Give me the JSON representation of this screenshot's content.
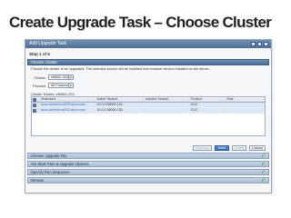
{
  "slide": {
    "title": "Create Upgrade Task – Choose Cluster"
  },
  "dialog": {
    "title": "Add Upgrade Task",
    "step": "Step 1 of 5",
    "sections": {
      "choose_cluster": "Choose Cluster",
      "choose_upgrade_file": "Choose Upgrade File",
      "set_start_time": "Set Start Time & Upgrade Options",
      "specify_run_sequence": "Specify Run Sequence",
      "review": "Review"
    },
    "description": "Choose the cluster to be upgraded. The selected version will be installed over inactive version installed on the server.",
    "cluster_label": "Cluster",
    "cluster_value": "vM062-203",
    "product_label": "Product",
    "product_value": "All Products",
    "cluster_node_label": "Cluster Nodes: vM062-203",
    "table": {
      "headers": [
        "Hostname",
        "Active Version",
        "Inactive Version",
        "Product",
        "Role"
      ],
      "rows": [
        {
          "hostname": "ucbu-aricent-vm203.cisco.com",
          "active": "10.0.0.98000-130",
          "inactive": "",
          "product": "CUC",
          "role": ""
        },
        {
          "hostname": "ucbu-aricent-vm202.cisco.com",
          "active": "10.0.0.98000-130",
          "inactive": "",
          "product": "CUC",
          "role": ""
        }
      ]
    },
    "buttons": {
      "previous": "Previous",
      "next": "Next",
      "finish": "Finish",
      "cancel": "Cancel"
    }
  },
  "colors": {
    "accent": "#4c6d94",
    "check": "#3fa535"
  }
}
